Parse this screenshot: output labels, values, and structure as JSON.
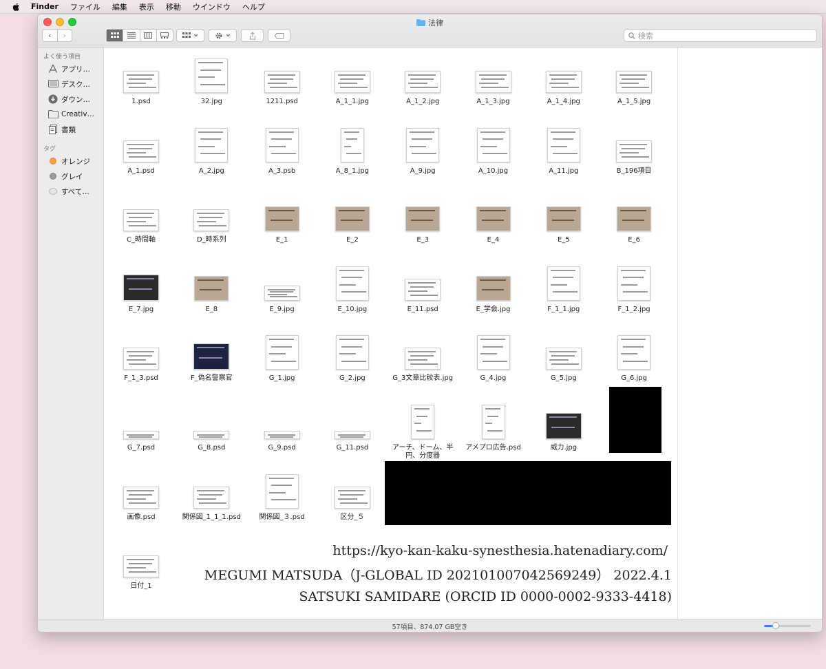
{
  "menubar": {
    "app": "Finder",
    "items": [
      "ファイル",
      "編集",
      "表示",
      "移動",
      "ウインドウ",
      "ヘルプ"
    ]
  },
  "window": {
    "title": "法律",
    "search_placeholder": "検索",
    "status": "57項目、874.07 GB空き",
    "icon_size_level": 0.25
  },
  "sidebar": {
    "favorites_heading": "よく使う項目",
    "favorites": [
      {
        "label": "アプリ…",
        "icon": "applications-icon"
      },
      {
        "label": "デスク…",
        "icon": "desktop-icon"
      },
      {
        "label": "ダウン…",
        "icon": "downloads-icon"
      },
      {
        "label": "Creativ…",
        "icon": "folder-icon"
      },
      {
        "label": "書類",
        "icon": "documents-icon"
      }
    ],
    "tags_heading": "タグ",
    "tags": [
      {
        "label": "オレンジ",
        "color": "#f4a04a"
      },
      {
        "label": "グレイ",
        "color": "#9a9a9a"
      },
      {
        "label": "すべて…",
        "color": "#e6e6e6"
      }
    ]
  },
  "files": [
    {
      "name": "1.psd",
      "kind": "wide"
    },
    {
      "name": "32.jpg",
      "kind": "doc"
    },
    {
      "name": "1211.psd",
      "kind": "wide"
    },
    {
      "name": "A_1_1.jpg",
      "kind": "wide"
    },
    {
      "name": "A_1_2.jpg",
      "kind": "wide"
    },
    {
      "name": "A_1_3.jpg",
      "kind": "wide"
    },
    {
      "name": "A_1_4.jpg",
      "kind": "wide"
    },
    {
      "name": "A_1_5.jpg",
      "kind": "wide"
    },
    {
      "name": "A_1.psd",
      "kind": "wide"
    },
    {
      "name": "A_2.jpg",
      "kind": "doc"
    },
    {
      "name": "A_3.psb",
      "kind": "doc"
    },
    {
      "name": "A_8_1.jpg",
      "kind": "tall"
    },
    {
      "name": "A_9.jpg",
      "kind": "doc"
    },
    {
      "name": "A_10.jpg",
      "kind": "doc"
    },
    {
      "name": "A_11.jpg",
      "kind": "doc"
    },
    {
      "name": "B_196項目",
      "kind": "wide"
    },
    {
      "name": "C_時間軸",
      "kind": "wide"
    },
    {
      "name": "D_時系列",
      "kind": "wide"
    },
    {
      "name": "E_1",
      "kind": "photo"
    },
    {
      "name": "E_2",
      "kind": "photo"
    },
    {
      "name": "E_3",
      "kind": "photo"
    },
    {
      "name": "E_4",
      "kind": "photo"
    },
    {
      "name": "E_5",
      "kind": "photo"
    },
    {
      "name": "E_6",
      "kind": "photo"
    },
    {
      "name": "E_7.jpg",
      "kind": "dark"
    },
    {
      "name": "E_8",
      "kind": "photo"
    },
    {
      "name": "E_9.jpg",
      "kind": "flat"
    },
    {
      "name": "E_10.jpg",
      "kind": "doc"
    },
    {
      "name": "E_11.psd",
      "kind": "wide"
    },
    {
      "name": "E_学会.jpg",
      "kind": "photo"
    },
    {
      "name": "F_1_1.jpg",
      "kind": "doc"
    },
    {
      "name": "F_1_2.jpg",
      "kind": "doc"
    },
    {
      "name": "F_1_3.psd",
      "kind": "wide"
    },
    {
      "name": "F_偽名警察官",
      "kind": "dark"
    },
    {
      "name": "G_1.jpg",
      "kind": "doc"
    },
    {
      "name": "G_2.jpg",
      "kind": "doc"
    },
    {
      "name": "G_3文章比較表.jpg",
      "kind": "wide"
    },
    {
      "name": "G_4.jpg",
      "kind": "doc"
    },
    {
      "name": "G_5.jpg",
      "kind": "wide"
    },
    {
      "name": "G_6.jpg",
      "kind": "doc"
    },
    {
      "name": "G_7.psd",
      "kind": "strip"
    },
    {
      "name": "G_8.psd",
      "kind": "strip"
    },
    {
      "name": "G_9.psd",
      "kind": "strip"
    },
    {
      "name": "G_11.psd",
      "kind": "strip"
    },
    {
      "name": "アーチ、ドーム、半円、分度器",
      "kind": "tall"
    },
    {
      "name": "アメプロ広告.psd",
      "kind": "tall"
    },
    {
      "name": "威力.jpg",
      "kind": "dark"
    },
    {
      "name": "",
      "kind": "hidden"
    },
    {
      "name": "画像.psd",
      "kind": "wide"
    },
    {
      "name": "関係図_1_1_1.psd",
      "kind": "wide"
    },
    {
      "name": "関係図_３.psd",
      "kind": "doc"
    },
    {
      "name": "区分_５",
      "kind": "wide"
    },
    {
      "name": "",
      "kind": "hidden"
    },
    {
      "name": "",
      "kind": "hidden"
    },
    {
      "name": "",
      "kind": "hidden"
    },
    {
      "name": "",
      "kind": "hidden"
    },
    {
      "name": "日付_1",
      "kind": "wide"
    }
  ],
  "overlay": {
    "url": "https://kyo-kan-kaku-synesthesia.hatenadiary.com/",
    "line2": "MEGUMI MATSUDA（J-GLOBAL ID 202101007042569249）  2022.4.1",
    "line3": "SATSUKI SAMIDARE (ORCID ID 0000-0002-9333-4418)"
  }
}
